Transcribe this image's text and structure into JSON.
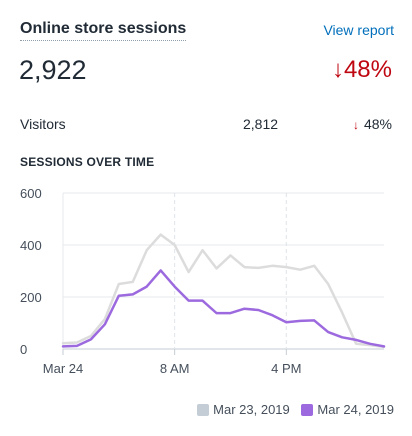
{
  "card": {
    "title": "Online store sessions",
    "view_report": "View report",
    "total": "2,922",
    "total_change": "↓48%",
    "visitors_label": "Visitors",
    "visitors_value": "2,812",
    "visitors_change_arrow": "↓",
    "visitors_change_value": "48%",
    "section_heading": "SESSIONS OVER TIME"
  },
  "colors": {
    "negative": "#bf0711",
    "link": "#006fbb",
    "series_previous": "#dcdcdc",
    "series_current": "#9c6ade",
    "legend_previous": "#c4cdd5",
    "legend_current": "#9c6ade"
  },
  "chart_data": {
    "type": "line",
    "title": "SESSIONS OVER TIME",
    "xlabel": "",
    "ylabel": "",
    "x_hours": [
      0,
      1,
      2,
      3,
      4,
      5,
      6,
      7,
      8,
      9,
      10,
      11,
      12,
      13,
      14,
      15,
      16,
      17,
      18,
      19,
      20,
      21,
      22,
      23
    ],
    "xticks": [
      {
        "hour": 0,
        "label": "Mar 24"
      },
      {
        "hour": 8,
        "label": "8 AM"
      },
      {
        "hour": 16,
        "label": "4 PM"
      }
    ],
    "yticks": [
      0,
      200,
      400,
      600
    ],
    "ylim": [
      0,
      600
    ],
    "xlim": [
      0,
      23
    ],
    "grid": {
      "horizontal": true,
      "vertical_dashed": true
    },
    "legend_position": "bottom-right",
    "series": [
      {
        "name": "Mar 23, 2019",
        "values": [
          22,
          25,
          50,
          115,
          250,
          258,
          380,
          440,
          400,
          296,
          380,
          310,
          360,
          315,
          312,
          320,
          315,
          305,
          320,
          250,
          140,
          20,
          15,
          8
        ]
      },
      {
        "name": "Mar 24, 2019",
        "values": [
          10,
          12,
          37,
          95,
          205,
          210,
          240,
          302,
          240,
          186,
          186,
          138,
          138,
          155,
          150,
          130,
          103,
          108,
          110,
          65,
          45,
          35,
          20,
          10
        ]
      }
    ]
  }
}
